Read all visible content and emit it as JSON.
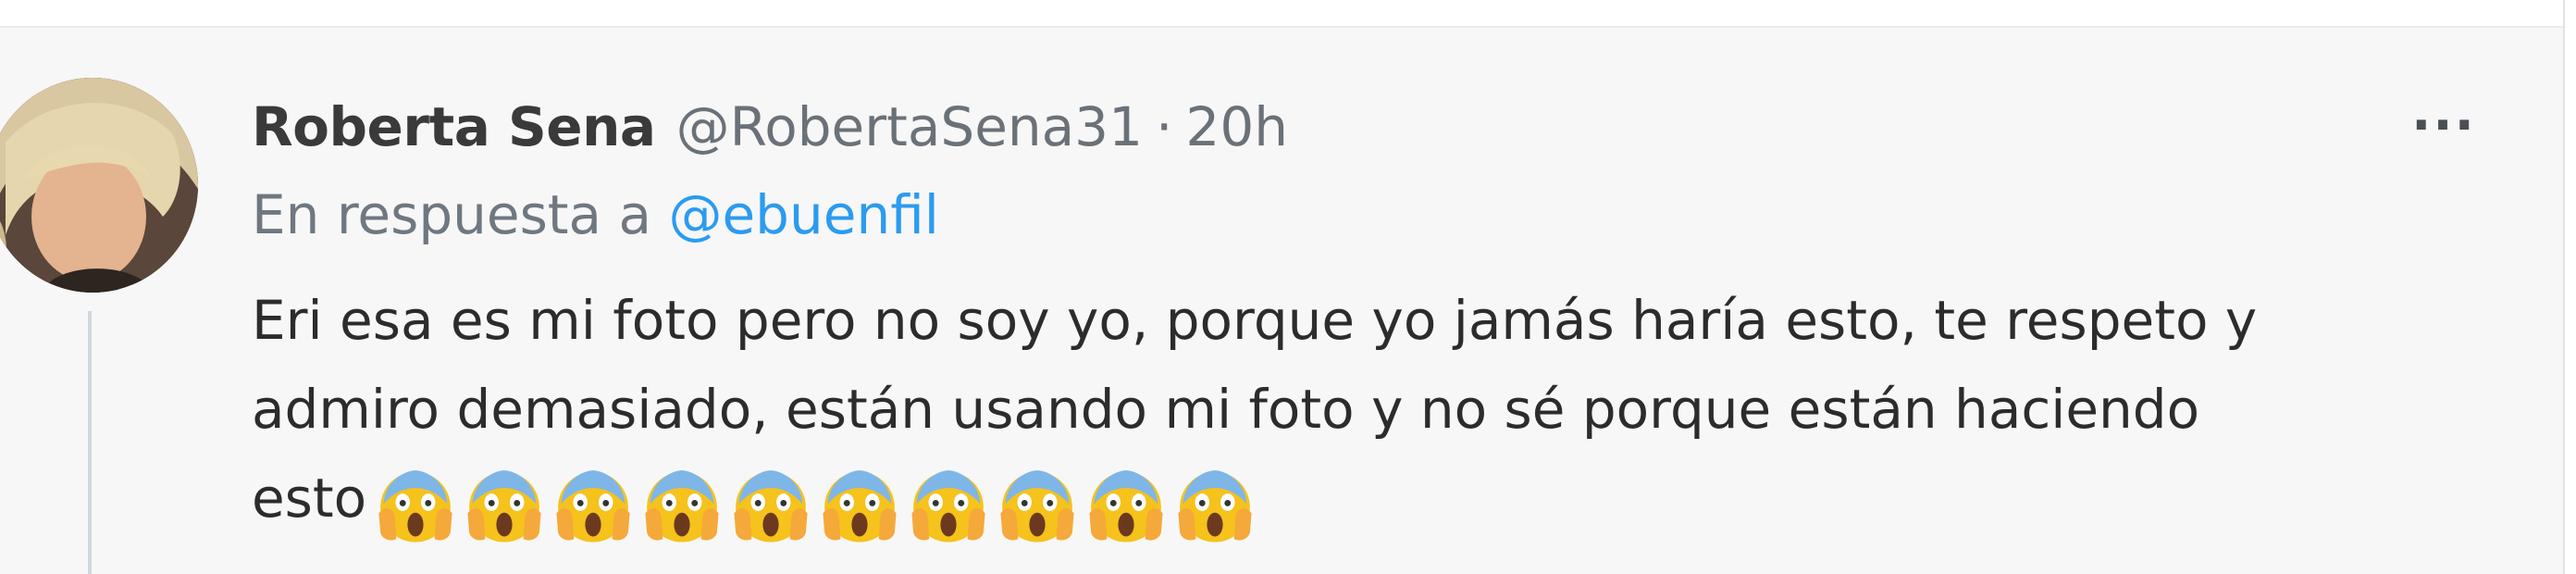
{
  "tweet": {
    "display_name": "Roberta Sena",
    "handle": "@RobertaSena31",
    "separator": "·",
    "time": "20h",
    "more_label": "···",
    "reply_prefix": "En respuesta a",
    "reply_to": "@ebuenfil",
    "text_lines": [
      "Eri esa es mi foto pero no soy yo, porque yo jamás haría esto, te respeto y",
      "admiro demasiado, están usando mi foto y no sé porque están haciendo",
      "esto"
    ],
    "emoji": "face-screaming-in-fear",
    "emoji_count": 10
  },
  "colors": {
    "background": "#f7f7f7",
    "name": "#3a3a3a",
    "muted": "#6a7178",
    "link": "#2b9bf0",
    "text": "#2c2c2c",
    "thread_line": "#cfd9de"
  }
}
